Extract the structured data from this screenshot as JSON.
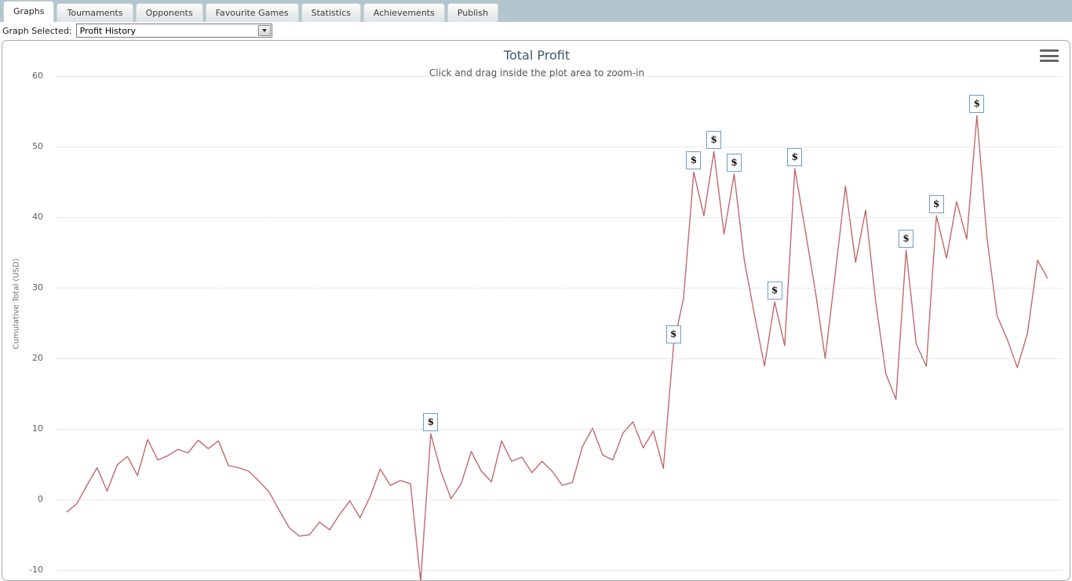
{
  "tabs": [
    {
      "label": "Graphs",
      "active": true
    },
    {
      "label": "Tournaments",
      "active": false
    },
    {
      "label": "Opponents",
      "active": false
    },
    {
      "label": "Favourite Games",
      "active": false
    },
    {
      "label": "Statistics",
      "active": false
    },
    {
      "label": "Achievements",
      "active": false
    },
    {
      "label": "Publish",
      "active": false
    }
  ],
  "selector": {
    "label": "Graph Selected:",
    "value": "Profit History",
    "options": [
      "Profit History"
    ]
  },
  "menu": {
    "icon": "hamburger-menu-icon"
  },
  "colors": {
    "line": "#c0696c",
    "title": "#3e576f",
    "grid": "#d2d2d2",
    "flag_border": "#6b9ec4",
    "tabstrip": "#b3c6ce"
  },
  "chart_data": {
    "type": "line",
    "title": "Total Profit",
    "subtitle": "Click and drag inside the plot area to zoom-in",
    "xlabel": "",
    "ylabel": "Cumulative Total (USD)",
    "ylim": [
      -10,
      60
    ],
    "yticks": [
      60,
      50,
      40,
      30,
      20,
      10,
      0,
      -10
    ],
    "grid": true,
    "legend": false,
    "series": [
      {
        "name": "Cumulative Total (USD)",
        "values": [
          -1.8,
          -0.6,
          2.0,
          4.5,
          1.2,
          4.9,
          6.1,
          3.4,
          8.5,
          5.6,
          6.2,
          7.1,
          6.6,
          8.4,
          7.2,
          8.3,
          4.8,
          4.5,
          4.0,
          2.6,
          1.1,
          -1.5,
          -4.0,
          -5.2,
          -5.0,
          -3.2,
          -4.3,
          -2.1,
          -0.2,
          -2.6,
          0.4,
          4.3,
          2.0,
          2.7,
          2.2,
          -11.6,
          9.3,
          4.0,
          0.1,
          2.2,
          6.8,
          4.0,
          2.5,
          8.3,
          5.4,
          6.0,
          3.8,
          5.4,
          4.0,
          2.0,
          2.4,
          7.5,
          10.1,
          6.3,
          5.6,
          9.4,
          11.0,
          7.3,
          9.7,
          4.4,
          21.8,
          28.6,
          46.4,
          40.2,
          49.3,
          37.6,
          46.1,
          33.9,
          26.2,
          18.9,
          28.0,
          21.8,
          46.9,
          38.4,
          29.8,
          20.0,
          32.1,
          44.4,
          33.6,
          41.0,
          28.0,
          17.8,
          14.2,
          35.3,
          22.0,
          18.9,
          40.2,
          34.2,
          42.2,
          36.9,
          54.4,
          37.0,
          26.0,
          22.7,
          18.7,
          23.5,
          33.9,
          31.3
        ]
      }
    ],
    "annotations": [
      {
        "icon": "dollar-flag",
        "label": "$",
        "index": 36,
        "value": 9.3
      },
      {
        "icon": "dollar-flag",
        "label": "$",
        "index": 60,
        "value": 21.8
      },
      {
        "icon": "dollar-flag",
        "label": "$",
        "index": 62,
        "value": 46.4
      },
      {
        "icon": "dollar-flag",
        "label": "$",
        "index": 64,
        "value": 49.3
      },
      {
        "icon": "dollar-flag",
        "label": "$",
        "index": 66,
        "value": 46.1
      },
      {
        "icon": "dollar-flag",
        "label": "$",
        "index": 70,
        "value": 28.0
      },
      {
        "icon": "dollar-flag",
        "label": "$",
        "index": 72,
        "value": 46.9
      },
      {
        "icon": "dollar-flag",
        "label": "$",
        "index": 83,
        "value": 35.3
      },
      {
        "icon": "dollar-flag",
        "label": "$",
        "index": 86,
        "value": 40.2
      },
      {
        "icon": "dollar-flag",
        "label": "$",
        "index": 90,
        "value": 54.4
      }
    ]
  }
}
